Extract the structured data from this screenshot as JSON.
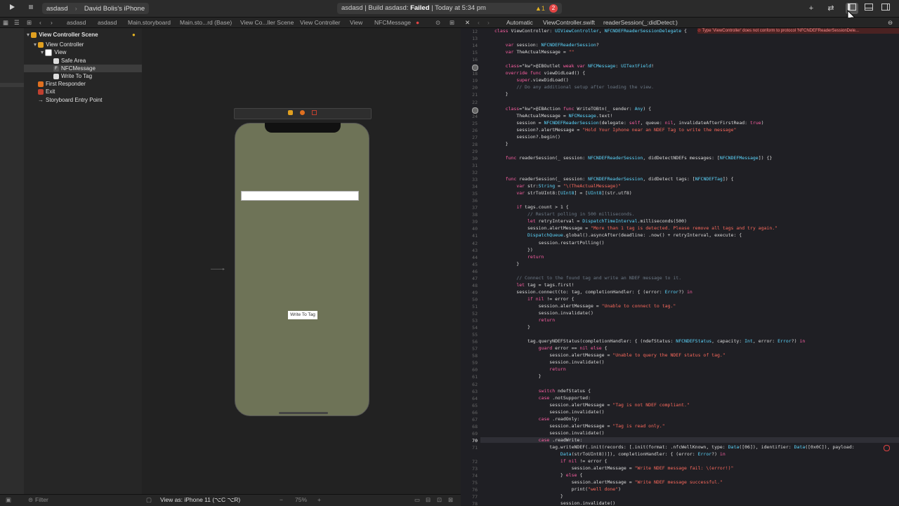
{
  "toolbar": {
    "scheme_project": "asdasd",
    "scheme_device": "David Bolis's iPhone",
    "status_prefix": "asdasd | Build asdasd: ",
    "status_result": "Failed",
    "status_time": " | Today at 5:34 pm",
    "warning_count": "1",
    "error_count": "2"
  },
  "left_jumpbar": [
    "asdasd",
    "asdasd",
    "Main.storyboard",
    "Main.sto...rd (Base)",
    "View Co...ller Scene",
    "View Controller",
    "View",
    "NFCMessage"
  ],
  "right_jumpbar": [
    "Automatic",
    "ViewController.swift",
    "readerSession(_:didDetect:)"
  ],
  "outline": [
    {
      "label": "View Controller Scene",
      "indent": 0,
      "expanded": true,
      "icon": "scene-icon"
    },
    {
      "label": "View Controller",
      "indent": 1,
      "expanded": true,
      "icon": "view-controller-icon"
    },
    {
      "label": "View",
      "indent": 2,
      "expanded": true,
      "icon": "view-icon"
    },
    {
      "label": "Safe Area",
      "indent": 3,
      "icon": "safe-area-icon"
    },
    {
      "label": "NFCMessage",
      "indent": 3,
      "icon": "textfield-icon",
      "selected": true
    },
    {
      "label": "Write To Tag",
      "indent": 3,
      "icon": "button-icon"
    },
    {
      "label": "First Responder",
      "indent": 1,
      "icon": "first-responder-icon"
    },
    {
      "label": "Exit",
      "indent": 1,
      "icon": "exit-icon"
    },
    {
      "label": "Storyboard Entry Point",
      "indent": 1,
      "icon": "entry-point-icon"
    }
  ],
  "canvas": {
    "button_label": "Write To Tag",
    "view_as": "View as: iPhone 11 (⌥C ⌥R)",
    "zoom": "75%",
    "filter_placeholder": "Filter"
  },
  "editor": {
    "error_banner": "Type 'ViewController' does not conform to protocol 'NFCNDEFReaderSessionDele...",
    "current_line": "70",
    "lines": [
      [
        "12",
        "class ViewController: UIViewController, NFCNDEFReaderSessionDelegate {"
      ],
      [
        "13",
        ""
      ],
      [
        "14",
        "    var session: NFCNDEFReaderSession?"
      ],
      [
        "15",
        "    var TheActualMessage = \"\""
      ],
      [
        "16",
        ""
      ],
      [
        "17",
        "    @IBOutlet weak var NFCMessage: UITextField!"
      ],
      [
        "18",
        "    override func viewDidLoad() {"
      ],
      [
        "19",
        "        super.viewDidLoad()"
      ],
      [
        "20",
        "        // Do any additional setup after loading the view."
      ],
      [
        "21",
        "    }"
      ],
      [
        "22",
        ""
      ],
      [
        "23",
        "    @IBAction func WriteTOBtn(_ sender: Any) {"
      ],
      [
        "24",
        "        TheActualMessage = NFCMessage.text!"
      ],
      [
        "25",
        "        session = NFCNDEFReaderSession(delegate: self, queue: nil, invalidateAfterFirstRead: true)"
      ],
      [
        "26",
        "        session?.alertMessage = \"Hold Your Iphone near an NDEF Tag to write the message\""
      ],
      [
        "27",
        "        session?.begin()"
      ],
      [
        "28",
        "    }"
      ],
      [
        "29",
        ""
      ],
      [
        "30",
        "    func readerSession(_ session: NFCNDEFReaderSession, didDetectNDEFs messages: [NFCNDEFMessage]) {}"
      ],
      [
        "31",
        ""
      ],
      [
        "32",
        ""
      ],
      [
        "33",
        "    func readerSession(_ session: NFCNDEFReaderSession, didDetect tags: [NFCNDEFTag]) {"
      ],
      [
        "34",
        "        var str:String = \"\\(TheActualMessage)\""
      ],
      [
        "35",
        "        var strToUInt8:[UInt8] = [UInt8](str.utf8)"
      ],
      [
        "36",
        ""
      ],
      [
        "37",
        "        if tags.count > 1 {"
      ],
      [
        "38",
        "            // Restart polling in 500 milliseconds."
      ],
      [
        "39",
        "            let retryInterval = DispatchTimeInterval.milliseconds(500)"
      ],
      [
        "40",
        "            session.alertMessage = \"More than 1 tag is detected. Please remove all tags and try again.\""
      ],
      [
        "41",
        "            DispatchQueue.global().asyncAfter(deadline: .now() + retryInterval, execute: {"
      ],
      [
        "42",
        "                session.restartPolling()"
      ],
      [
        "43",
        "            })"
      ],
      [
        "44",
        "            return"
      ],
      [
        "45",
        "        }"
      ],
      [
        "46",
        ""
      ],
      [
        "47",
        "        // Connect to the found tag and write an NDEF message to it."
      ],
      [
        "48",
        "        let tag = tags.first!"
      ],
      [
        "49",
        "        session.connect(to: tag, completionHandler: { (error: Error?) in"
      ],
      [
        "50",
        "            if nil != error {"
      ],
      [
        "51",
        "                session.alertMessage = \"Unable to connect to tag.\""
      ],
      [
        "52",
        "                session.invalidate()"
      ],
      [
        "53",
        "                return"
      ],
      [
        "54",
        "            }"
      ],
      [
        "55",
        ""
      ],
      [
        "56",
        "            tag.queryNDEFStatus(completionHandler: { (ndefStatus: NFCNDEFStatus, capacity: Int, error: Error?) in"
      ],
      [
        "57",
        "                guard error == nil else {"
      ],
      [
        "58",
        "                    session.alertMessage = \"Unable to query the NDEF status of tag.\""
      ],
      [
        "59",
        "                    session.invalidate()"
      ],
      [
        "60",
        "                    return"
      ],
      [
        "61",
        "                }"
      ],
      [
        "62",
        ""
      ],
      [
        "63",
        "                switch ndefStatus {"
      ],
      [
        "64",
        "                case .notSupported:"
      ],
      [
        "65",
        "                    session.alertMessage = \"Tag is not NDEF compliant.\""
      ],
      [
        "66",
        "                    session.invalidate()"
      ],
      [
        "67",
        "                case .readOnly:"
      ],
      [
        "68",
        "                    session.alertMessage = \"Tag is read only.\""
      ],
      [
        "69",
        "                    session.invalidate()"
      ],
      [
        "70",
        "                case .readWrite:"
      ],
      [
        "71",
        "                    tag.writeNDEF(.init(records: [.init(format: .nfcWellKnown, type: Data([06]), identifier: Data([0x0C]), payload:"
      ],
      [
        "",
        "                        Data(strToUInt8))]), completionHandler: { (error: Error?) in"
      ],
      [
        "72",
        "                        if nil != error {"
      ],
      [
        "73",
        "                            session.alertMessage = \"Write NDEF message fail: \\(error!)\""
      ],
      [
        "74",
        "                        } else {"
      ],
      [
        "75",
        "                            session.alertMessage = \"Write NDEF message successful.\""
      ],
      [
        "76",
        "                            print(\"well done\")"
      ],
      [
        "77",
        "                        }"
      ],
      [
        "78",
        "                        session.invalidate()"
      ]
    ]
  },
  "colors": {
    "phone_background": "#6e7357",
    "error": "#e24444",
    "warning": "#e6b422"
  }
}
